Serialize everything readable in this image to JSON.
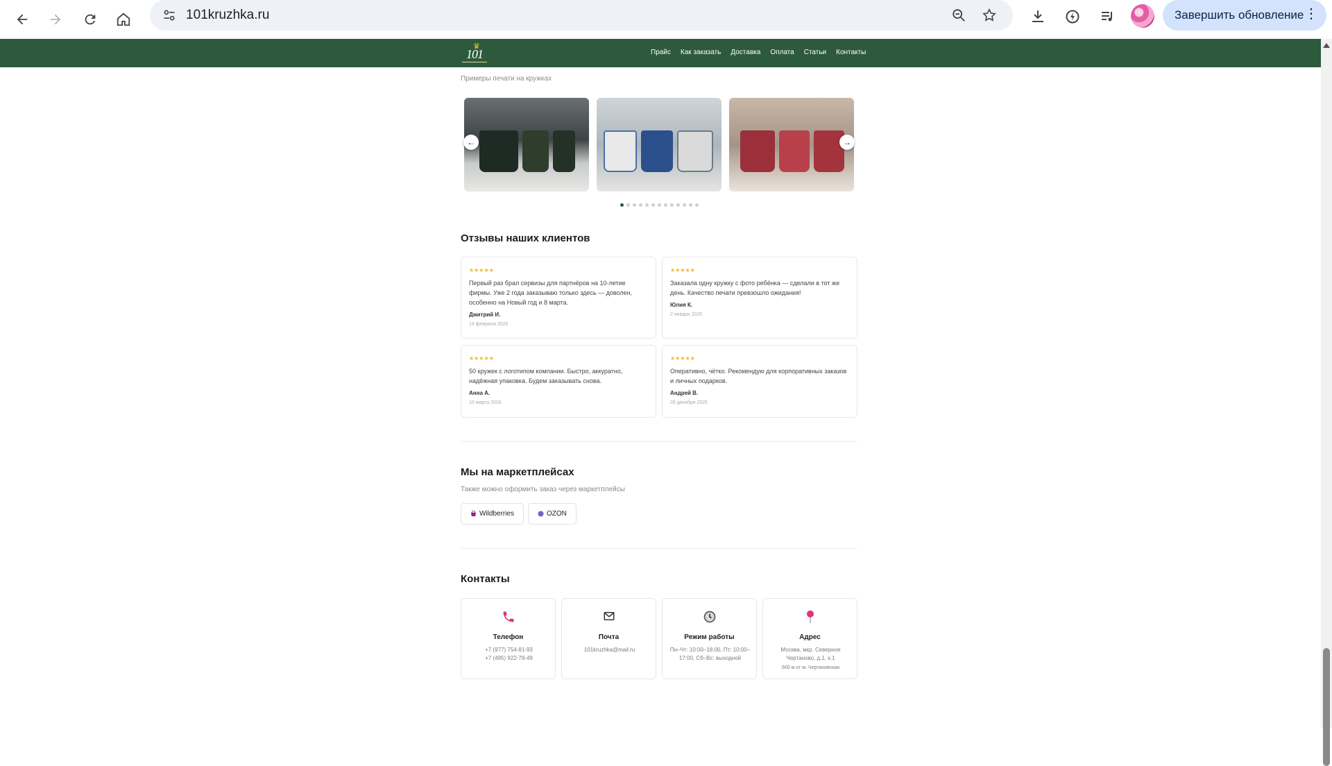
{
  "browser": {
    "url": "101kruzhka.ru",
    "update_label": "Завершить обновление"
  },
  "header": {
    "logo_text": "101",
    "nav": [
      "Прайс",
      "Как заказать",
      "Доставка",
      "Оплата",
      "Статьи",
      "Контакты"
    ]
  },
  "gallery": {
    "subtitle": "Примеры печати на кружках",
    "total_slides": 13,
    "active_slide": 1,
    "prev_label": "←",
    "next_label": "→"
  },
  "reviews": {
    "title": "Отзывы наших клиентов",
    "stars": "★★★★★",
    "items": [
      {
        "text": "Первый раз брал сервизы для партнёров на 10-летие фирмы. Уже 2 года заказываю только здесь — доволен, особенно на Новый год и 8 марта.",
        "author": "Дмитрий И.",
        "date": "14 февраля 2026"
      },
      {
        "text": "Заказала одну кружку с фото ребёнка — сделали в тот же день. Качество печати превзошло ожидания!",
        "author": "Юлия К.",
        "date": "2 января 2026"
      },
      {
        "text": "50 кружек с логотипом компании. Быстро, аккуратно, надёжная упаковка. Будем заказывать снова.",
        "author": "Анна А.",
        "date": "10 марта 2026"
      },
      {
        "text": "Оперативно, чётко. Рекомендую для корпоративных заказов и личных подарков.",
        "author": "Андрей В.",
        "date": "28 декабря 2025"
      }
    ]
  },
  "marketplaces": {
    "title": "Мы на маркетплейсах",
    "subtitle": "Также можно оформить заказ через маркетплейсы",
    "items": [
      {
        "label": "Wildberries",
        "icon": "bag-icon",
        "color": "#8b2a8b"
      },
      {
        "label": "OZON",
        "icon": "circle-icon",
        "color": "#7b5fc4"
      }
    ]
  },
  "contacts": {
    "title": "Контакты",
    "items": [
      {
        "title": "Телефон",
        "icon": "phone-icon",
        "lines": [
          "+7 (977) 754-81-93",
          "+7 (495) 922-79-49"
        ]
      },
      {
        "title": "Почта",
        "icon": "mail-icon",
        "lines": [
          "101kruzhka@mail.ru"
        ]
      },
      {
        "title": "Режим работы",
        "icon": "clock-icon",
        "lines": [
          "Пн–Чт: 10:00–18:00, Пт: 10:00–17:00, Сб–Вс: выходной"
        ]
      },
      {
        "title": "Адрес",
        "icon": "pin-icon",
        "lines": [
          "Москва, мкр. Северное Чертаново, д.1, к.1",
          "600 м от м. Чертановская"
        ]
      }
    ]
  },
  "colors": {
    "header_green": "#2d5a3d",
    "star": "#f3b62a",
    "accent_pink": "#e0337a"
  }
}
